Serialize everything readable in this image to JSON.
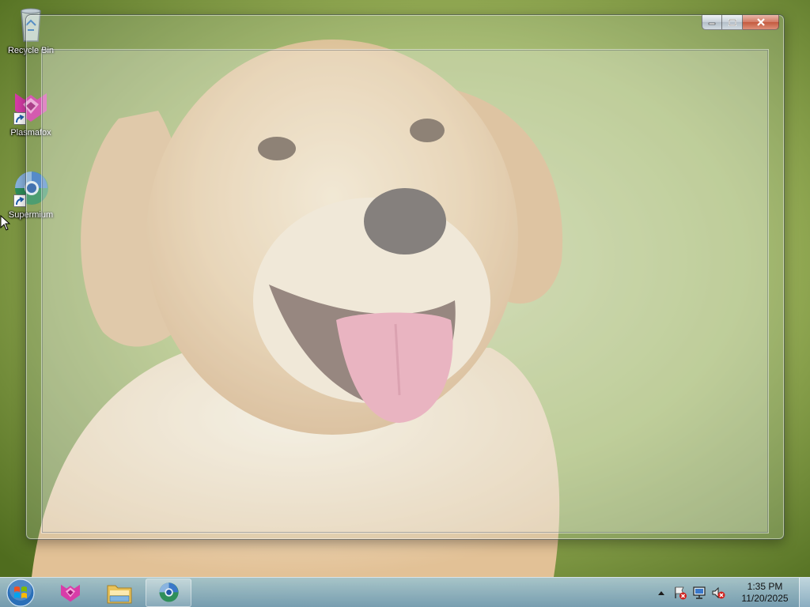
{
  "desktop": {
    "icons": [
      {
        "label": "Recycle Bin",
        "icon": "recycle-bin-icon"
      },
      {
        "label": "Plasmafox",
        "icon": "plasmafox-icon"
      },
      {
        "label": "Supermium",
        "icon": "supermium-icon"
      }
    ]
  },
  "window": {
    "caption_buttons": [
      "minimize-icon",
      "maximize-icon",
      "close-icon"
    ]
  },
  "taskbar": {
    "start_icon": "windows-logo-icon",
    "pinned": [
      {
        "icon": "plasmafox-icon",
        "running": false
      },
      {
        "icon": "file-explorer-icon",
        "running": false
      },
      {
        "icon": "supermium-icon",
        "running": true
      }
    ],
    "tray": {
      "icons": [
        "show-hidden-icons-icon",
        "action-center-icon",
        "network-icon",
        "volume-muted-icon"
      ],
      "time": "1:35 PM",
      "date": "11/20/2025"
    }
  },
  "colors": {
    "accent": "#1e6fd0",
    "plasmafox": "#d83ca8",
    "close_button": "#c45a3f",
    "tray_alert": "#d0201c"
  }
}
